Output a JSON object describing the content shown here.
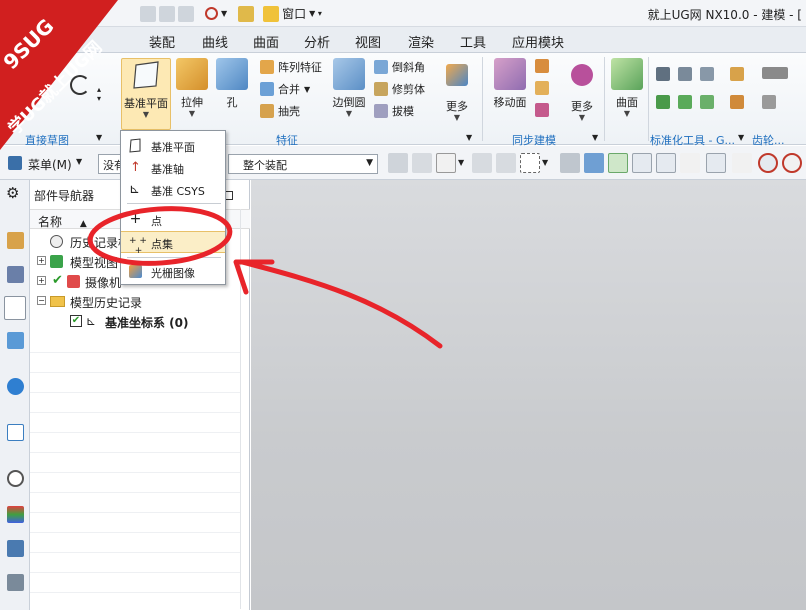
{
  "window": {
    "title": "就上UG网 NX10.0 - 建模 - ["
  },
  "quick_access": {
    "window_menu_label": "窗口"
  },
  "tabs": [
    {
      "label": "装配"
    },
    {
      "label": "曲线"
    },
    {
      "label": "曲面"
    },
    {
      "label": "分析"
    },
    {
      "label": "视图"
    },
    {
      "label": "渲染"
    },
    {
      "label": "工具"
    },
    {
      "label": "应用模块"
    }
  ],
  "ribbon": {
    "datum_plane": "基准平面",
    "extrude": "拉伸",
    "hole": "孔",
    "pattern_feature": "阵列特征",
    "unite": "合并",
    "shell": "抽壳",
    "edge_blend": "边倒圆",
    "chamfer": "倒斜角",
    "trim_body": "修剪体",
    "draft": "拔模",
    "more1": "更多",
    "move_face": "移动面",
    "more2": "更多",
    "surface": "曲面",
    "group_direct_sketch": "直接草图",
    "group_feature": "特征",
    "group_sync": "同步建模",
    "group_standard": "标准化工具 - G...",
    "group_gear": "齿轮..."
  },
  "toolbar": {
    "menu_label": "菜单(M)",
    "filter_value": "没有",
    "assembly_scope": "整个装配"
  },
  "navigator": {
    "title": "部件导航器",
    "column_name": "名称",
    "rows": [
      {
        "label": "历史记录模"
      },
      {
        "label": "模型视图"
      },
      {
        "label": "摄像机"
      },
      {
        "label": "模型历史记录"
      },
      {
        "label": "基准坐标系 (0)"
      }
    ]
  },
  "dropdown": {
    "items": [
      {
        "label": "基准平面"
      },
      {
        "label": "基准轴"
      },
      {
        "label": "基准 CSYS"
      },
      {
        "label": "点"
      },
      {
        "label": "点集"
      },
      {
        "label": "光栅图像"
      }
    ]
  },
  "watermark": {
    "line1": "9SUG",
    "line2": "学UG就上UG网"
  },
  "colors": {
    "accent": "#1f6fbf",
    "annotation": "#e8242a",
    "highlight": "#fbeec7"
  }
}
